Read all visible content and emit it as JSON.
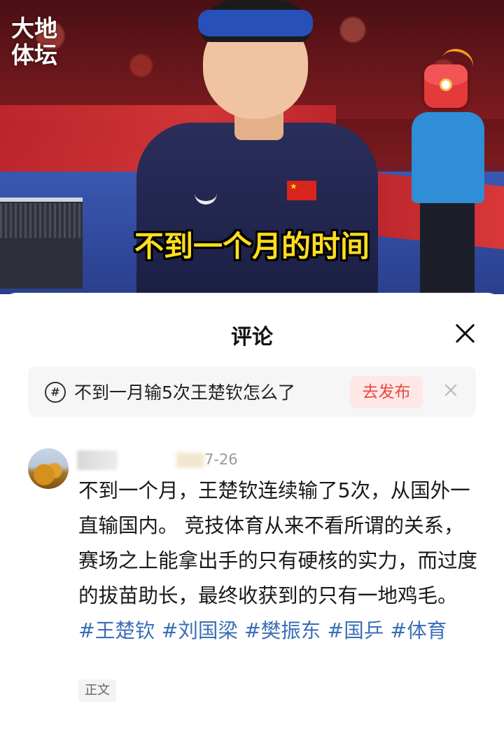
{
  "video": {
    "watermark": "大地体坛",
    "subtitle": "不到一个月的时间",
    "icons": [
      "red-packet-icon"
    ]
  },
  "sheet": {
    "title": "评论",
    "close_icon": "close-icon"
  },
  "topic_bar": {
    "icon": "hashtag-icon",
    "icon_glyph": "#",
    "text": "不到一月输5次王楚钦怎么了",
    "publish_label": "去发布",
    "dismiss_icon": "dismiss-icon"
  },
  "comment": {
    "date": "7-26",
    "text_parts": {
      "line": "不到一个月，王楚钦连续输了5次，从国外一直输国内。 竞技体育从来不看所谓的关系，赛场之上能拿出手的只有硬核的实力，而过度的拔苗助长，最终收获到的只有一地鸡毛。",
      "tag1": "#王楚钦",
      "tag2": "#刘国梁",
      "tag3": "#樊振东",
      "tag4": "#国乒",
      "tag5": "#体育"
    },
    "label": "正文"
  },
  "colors": {
    "subtitle": "#ffde1e",
    "hashtag": "#3a6fb7",
    "publish_text": "#e94a3f",
    "publish_bg": "#fde8e6"
  }
}
